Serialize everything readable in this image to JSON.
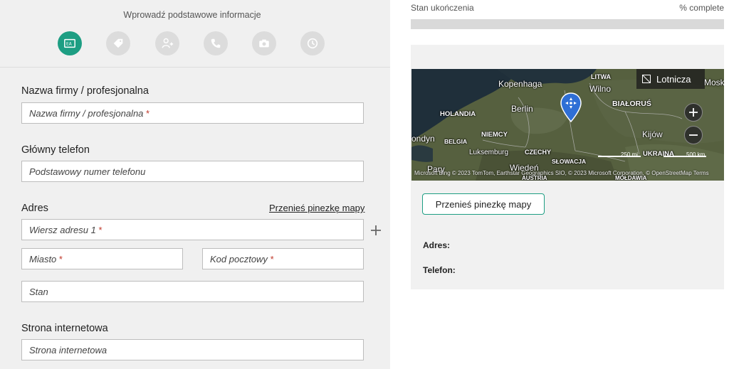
{
  "header": {
    "step_title": "Wprowadź podstawowe informacje",
    "steps": [
      {
        "icon": "business-card-icon",
        "active": true
      },
      {
        "icon": "tag-icon",
        "active": false
      },
      {
        "icon": "person-add-icon",
        "active": false
      },
      {
        "icon": "phone-icon",
        "active": false
      },
      {
        "icon": "camera-icon",
        "active": false
      },
      {
        "icon": "clock-icon",
        "active": false
      }
    ]
  },
  "form": {
    "business_name": {
      "label": "Nazwa firmy / profesjonalna",
      "placeholder": "Nazwa firmy / profesjonalna",
      "required": "*"
    },
    "phone": {
      "label": "Główny telefon",
      "placeholder": "Podstawowy numer telefonu"
    },
    "address": {
      "label": "Adres",
      "move_pin_link": "Przenieś pinezkę mapy",
      "line1_placeholder": "Wiersz adresu 1",
      "city_placeholder": "Miasto",
      "postal_placeholder": "Kod pocztowy",
      "state_placeholder": "Stan",
      "required": "*"
    },
    "website": {
      "label": "Strona internetowa",
      "placeholder": "Strona internetowa"
    }
  },
  "progress": {
    "label": "Stan ukończenia",
    "percent_text": "% complete",
    "value": 0
  },
  "map": {
    "style_button": "Lotnicza",
    "labels": {
      "litwa": "LITWA",
      "kopenhaga": "Kopenhaga",
      "wilno": "Wilno",
      "moskwa": "Moskwa",
      "holandia": "HOLANDIA",
      "berlin": "Berlin",
      "bialorus": "BIAŁORUŚ",
      "belgia": "BELGIA",
      "niemcy": "NIEMCY",
      "londyn": "ondyn",
      "kijow": "Kijów",
      "luksemburg": "Luksemburg",
      "czechy": "CZECHY",
      "ukraina": "UKRAINA",
      "slowacja": "SŁOWACJA",
      "paryz": "Pary",
      "wieden": "Wiedeń",
      "austria": "AUSTRIA",
      "moldawia": "MOŁDAWIA"
    },
    "scale_250": "250 mi",
    "scale_500": "500 km",
    "attribution": "Microsoft Bing  © 2023 TomTom, Earthstar Geographics SIO, © 2023 Microsoft Corporation, © OpenStreetMap  Terms"
  },
  "sidebar_card": {
    "move_pin_button": "Przenieś pinezkę mapy",
    "address_label": "Adres:",
    "phone_label": "Telefon:"
  }
}
